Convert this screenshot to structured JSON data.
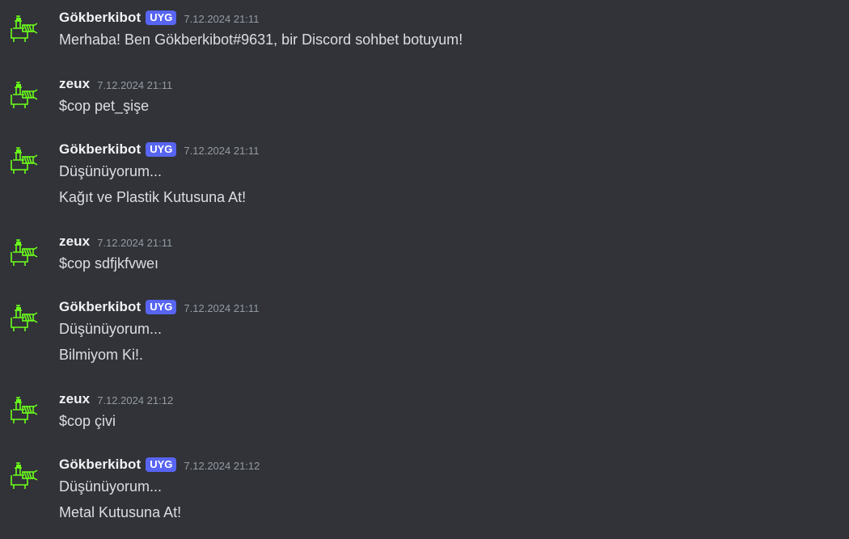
{
  "bot_badge": "UYG",
  "messages": [
    {
      "author": "Gökberkibot",
      "time": "7.12.2024 21:11",
      "lines": [
        "Merhaba! Ben Gökberkibot#9631, bir Discord sohbet botuyum!"
      ]
    },
    {
      "author": "zeux",
      "time": "7.12.2024 21:11",
      "lines": [
        "$cop pet_şişe"
      ]
    },
    {
      "author": "Gökberkibot",
      "time": "7.12.2024 21:11",
      "lines": [
        "Düşünüyorum...",
        "Kağıt ve Plastik Kutusuna At!"
      ]
    },
    {
      "author": "zeux",
      "time": "7.12.2024 21:11",
      "lines": [
        "$cop sdfjkfvweı"
      ]
    },
    {
      "author": "Gökberkibot",
      "time": "7.12.2024 21:11",
      "lines": [
        "Düşünüyorum...",
        "Bilmiyom Ki!."
      ]
    },
    {
      "author": "zeux",
      "time": "7.12.2024 21:12",
      "lines": [
        "$cop çivi"
      ]
    },
    {
      "author": "Gökberkibot",
      "time": "7.12.2024 21:12",
      "lines": [
        "Düşünüyorum...",
        "Metal Kutusuna At!"
      ]
    }
  ]
}
